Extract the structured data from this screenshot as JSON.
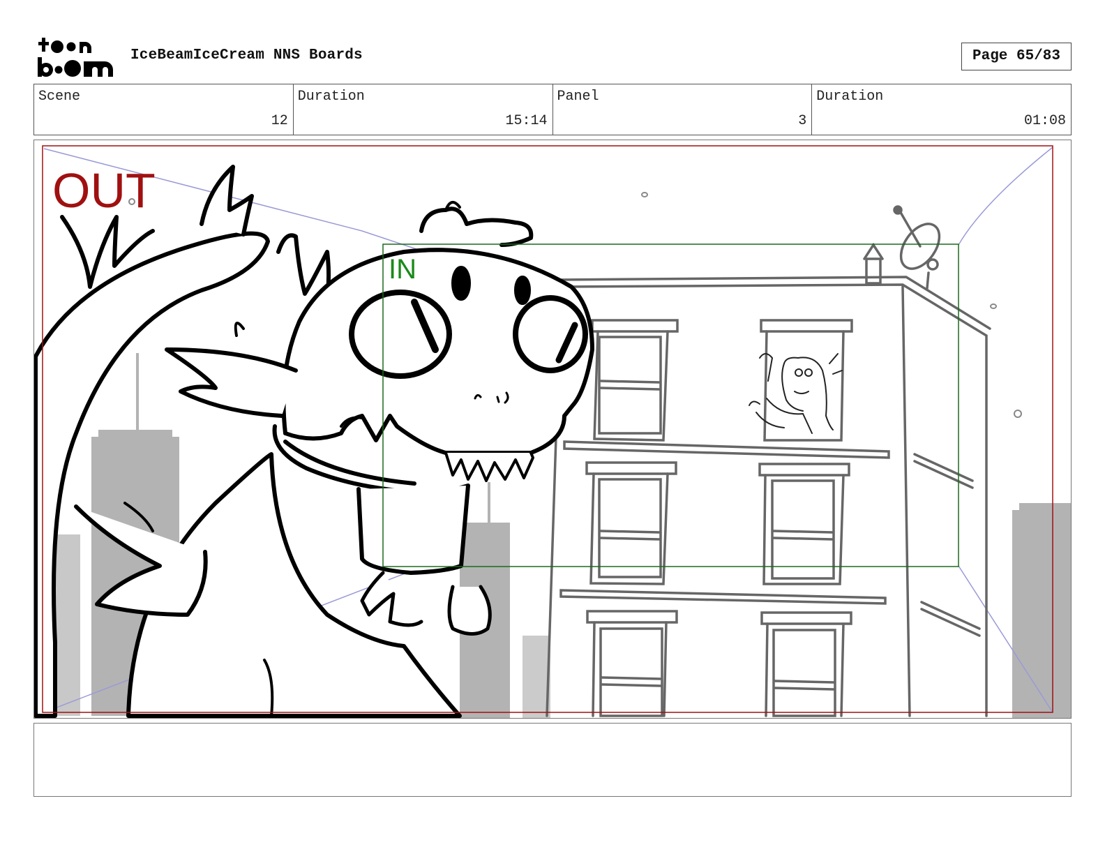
{
  "header": {
    "logo_top": "toon",
    "logo_bottom": "boom",
    "title": "IceBeamIceCream NNS Boards",
    "page": "Page 65/83"
  },
  "info": {
    "scene_label": "Scene",
    "scene_value": "12",
    "scene_duration_label": "Duration",
    "scene_duration_value": "15:14",
    "panel_label": "Panel",
    "panel_value": "3",
    "panel_duration_label": "Duration",
    "panel_duration_value": "01:08"
  },
  "panel": {
    "out_label": "OUT",
    "in_label": "IN",
    "out_color": "#a01010",
    "in_color": "#1a8a1a",
    "camera_guide_color": "#9a9ad8"
  },
  "notes": {
    "text": ""
  }
}
